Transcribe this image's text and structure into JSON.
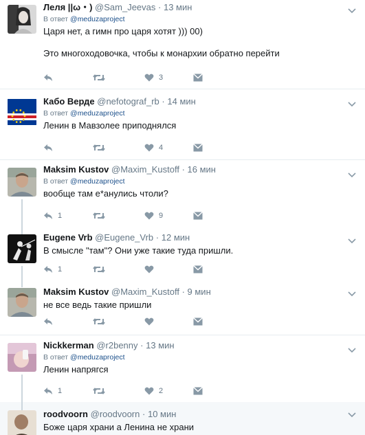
{
  "tweets": [
    {
      "name": "Леля ||ω・)",
      "handle": "@Sam_Jeevas",
      "dot": "·",
      "time": "13 мин",
      "reply_prefix": "В ответ",
      "reply_mention": "@meduzaproject",
      "text": "Царя нет, а гимн про царя хотят ))) 00)\n\nЭто многоходовочка, чтобы к монархии обратно перейти",
      "reply_count": "",
      "retweet_count": "",
      "like_count": "3",
      "avatar": "woman-photo"
    },
    {
      "name": "Кабо Верде",
      "handle": "@nefotograf_rb",
      "dot": "·",
      "time": "14 мин",
      "reply_prefix": "В ответ",
      "reply_mention": "@meduzaproject",
      "text": "Ленин в Мавзолее приподнялся",
      "reply_count": "",
      "retweet_count": "",
      "like_count": "4",
      "avatar": "cape-verde-flag"
    },
    {
      "name": "Maksim Kustov",
      "handle": "@Maxim_Kustoff",
      "dot": "·",
      "time": "16 мин",
      "reply_prefix": "В ответ",
      "reply_mention": "@meduzaproject",
      "text": "вообще там е*анулись чтоли?",
      "reply_count": "1",
      "retweet_count": "",
      "like_count": "9",
      "avatar": "man-photo"
    },
    {
      "name": "Eugene Vrb",
      "handle": "@Eugene_Vrb",
      "dot": "·",
      "time": "12 мин",
      "reply_prefix": "",
      "reply_mention": "",
      "text": "В смысле \"там\"? Они уже такие туда пришли.",
      "reply_count": "1",
      "retweet_count": "",
      "like_count": "",
      "avatar": "fencer-photo"
    },
    {
      "name": "Maksim Kustov",
      "handle": "@Maxim_Kustoff",
      "dot": "·",
      "time": "9 мин",
      "reply_prefix": "",
      "reply_mention": "",
      "text": "не все ведь такие пришли",
      "reply_count": "",
      "retweet_count": "",
      "like_count": "",
      "avatar": "man-photo"
    },
    {
      "name": "Nickkerman",
      "handle": "@r2benny",
      "dot": "·",
      "time": "13 мин",
      "reply_prefix": "В ответ",
      "reply_mention": "@meduzaproject",
      "text": "Ленин напрягся",
      "reply_count": "1",
      "retweet_count": "",
      "like_count": "2",
      "avatar": "pink-photo"
    },
    {
      "name": "roodvoorn",
      "handle": "@roodvoorn",
      "dot": "·",
      "time": "10 мин",
      "reply_prefix": "",
      "reply_mention": "",
      "text": "Боже царя храни а Ленина не храни",
      "reply_count": "",
      "retweet_count": "",
      "like_count": "",
      "avatar": "bald-man-photo"
    }
  ],
  "colors": {
    "icon": "#8899a6",
    "thread": "#ccd6dd",
    "mention": "#1b4f8a",
    "divider": "#e6ecf0"
  }
}
